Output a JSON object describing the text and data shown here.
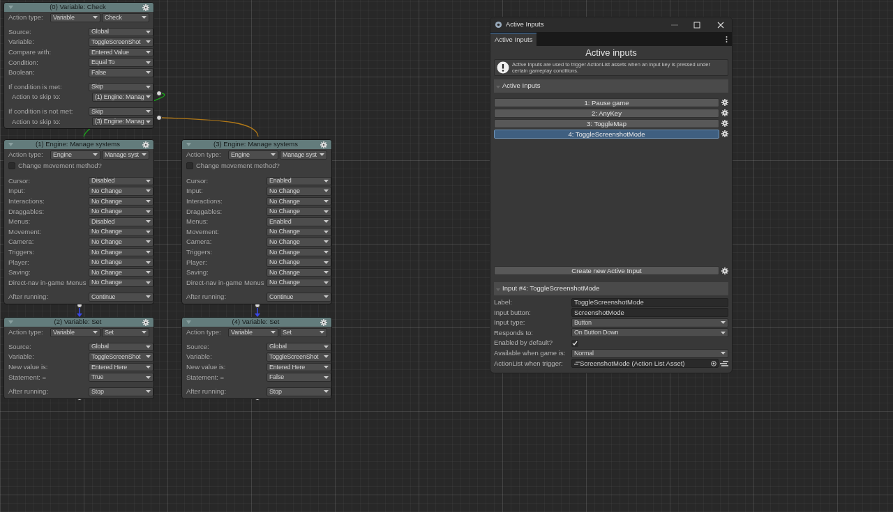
{
  "nodes": [
    {
      "title": "(0) Variable: Check",
      "groups": [
        [
          {
            "kind": "type",
            "label": "Action type:",
            "value": "Variable",
            "value2": "Check"
          }
        ],
        [
          {
            "kind": "dropdown",
            "label": "Source:",
            "value": "Global"
          },
          {
            "kind": "dropdown",
            "label": "Variable:",
            "value": "ToggleScreenShot"
          },
          {
            "kind": "dropdown",
            "label": "Compare with:",
            "value": "Entered Value"
          },
          {
            "kind": "dropdown",
            "label": "Condition:",
            "value": "Equal To"
          },
          {
            "kind": "dropdown",
            "label": "Boolean:",
            "value": "False"
          }
        ],
        [
          {
            "kind": "dropdown",
            "label": "If condition is met:",
            "value": "Skip"
          },
          {
            "kind": "skip",
            "label": "Action to skip to:",
            "value": "(1) Engine: Manag"
          }
        ],
        [
          {
            "kind": "dropdown",
            "label": "If condition is not met:",
            "value": "Skip"
          },
          {
            "kind": "skip",
            "label": "Action to skip to:",
            "value": "(3) Engine: Manag"
          }
        ]
      ]
    },
    {
      "title": "(1) Engine: Manage systems",
      "groups": [
        [
          {
            "kind": "type",
            "label": "Action type:",
            "value": "Engine",
            "value2": "Manage syst"
          },
          {
            "kind": "checkbox",
            "label": "Change movement method?",
            "checked": false
          }
        ],
        [
          {
            "kind": "dropdown",
            "label": "Cursor:",
            "value": "Disabled"
          },
          {
            "kind": "dropdown",
            "label": "Input:",
            "value": "No Change"
          },
          {
            "kind": "dropdown",
            "label": "Interactions:",
            "value": "No Change"
          },
          {
            "kind": "dropdown",
            "label": "Draggables:",
            "value": "No Change"
          },
          {
            "kind": "dropdown",
            "label": "Menus:",
            "value": "Disabled"
          },
          {
            "kind": "dropdown",
            "label": "Movement:",
            "value": "No Change"
          },
          {
            "kind": "dropdown",
            "label": "Camera:",
            "value": "No Change"
          },
          {
            "kind": "dropdown",
            "label": "Triggers:",
            "value": "No Change"
          },
          {
            "kind": "dropdown",
            "label": "Player:",
            "value": "No Change"
          },
          {
            "kind": "dropdown",
            "label": "Saving:",
            "value": "No Change"
          },
          {
            "kind": "dropdown",
            "label": "Direct-nav in-game Menus",
            "value": "No Change"
          }
        ],
        [
          {
            "kind": "dropdown",
            "label": "After running:",
            "value": "Continue"
          }
        ]
      ]
    },
    {
      "title": "(3) Engine: Manage systems",
      "groups": [
        [
          {
            "kind": "type",
            "label": "Action type:",
            "value": "Engine",
            "value2": "Manage syst"
          },
          {
            "kind": "checkbox",
            "label": "Change movement method?",
            "checked": false
          }
        ],
        [
          {
            "kind": "dropdown",
            "label": "Cursor:",
            "value": "Enabled"
          },
          {
            "kind": "dropdown",
            "label": "Input:",
            "value": "No Change"
          },
          {
            "kind": "dropdown",
            "label": "Interactions:",
            "value": "No Change"
          },
          {
            "kind": "dropdown",
            "label": "Draggables:",
            "value": "No Change"
          },
          {
            "kind": "dropdown",
            "label": "Menus:",
            "value": "Enabled"
          },
          {
            "kind": "dropdown",
            "label": "Movement:",
            "value": "No Change"
          },
          {
            "kind": "dropdown",
            "label": "Camera:",
            "value": "No Change"
          },
          {
            "kind": "dropdown",
            "label": "Triggers:",
            "value": "No Change"
          },
          {
            "kind": "dropdown",
            "label": "Player:",
            "value": "No Change"
          },
          {
            "kind": "dropdown",
            "label": "Saving:",
            "value": "No Change"
          },
          {
            "kind": "dropdown",
            "label": "Direct-nav in-game Menus",
            "value": "No Change"
          }
        ],
        [
          {
            "kind": "dropdown",
            "label": "After running:",
            "value": "Continue"
          }
        ]
      ]
    },
    {
      "title": "(2) Variable: Set",
      "groups": [
        [
          {
            "kind": "type",
            "label": "Action type:",
            "value": "Variable",
            "value2": "Set"
          }
        ],
        [
          {
            "kind": "dropdown",
            "label": "Source:",
            "value": "Global"
          },
          {
            "kind": "dropdown",
            "label": "Variable:",
            "value": "ToggleScreenShot"
          },
          {
            "kind": "dropdown",
            "label": "New value is:",
            "value": "Entered Here"
          },
          {
            "kind": "dropdown",
            "label": "Statement: =",
            "value": "True"
          }
        ],
        [
          {
            "kind": "dropdown",
            "label": "After running:",
            "value": "Stop"
          }
        ]
      ]
    },
    {
      "title": "(4) Variable: Set",
      "groups": [
        [
          {
            "kind": "type",
            "label": "Action type:",
            "value": "Variable",
            "value2": "Set"
          }
        ],
        [
          {
            "kind": "dropdown",
            "label": "Source:",
            "value": "Global"
          },
          {
            "kind": "dropdown",
            "label": "Variable:",
            "value": "ToggleScreenShot"
          },
          {
            "kind": "dropdown",
            "label": "New value is:",
            "value": "Entered Here"
          },
          {
            "kind": "dropdown",
            "label": "Statement: =",
            "value": "False"
          }
        ],
        [
          {
            "kind": "dropdown",
            "label": "After running:",
            "value": "Stop"
          }
        ]
      ]
    }
  ],
  "window": {
    "title": "Active Inputs",
    "tab": "Active Inputs",
    "heading": "Active inputs",
    "info": "Active Inputs are used to trigger ActionList assets when an input key is pressed under certain gameplay conditions.",
    "list_section": "Active Inputs",
    "inputs": [
      {
        "label": "1: Pause game",
        "selected": false
      },
      {
        "label": "2: AnyKey",
        "selected": false
      },
      {
        "label": "3: ToggleMap",
        "selected": false
      },
      {
        "label": "4: ToggleScreenshotMode",
        "selected": true
      }
    ],
    "create_button": "Create new Active Input",
    "detail_section": "Input #4: ToggleScreenshotMode",
    "fields": [
      {
        "kind": "text",
        "label": "Label:",
        "value": "ToggleScreenshotMode"
      },
      {
        "kind": "text",
        "label": "Input button:",
        "value": "ScreenshotMode"
      },
      {
        "kind": "dropdown",
        "label": "Input type:",
        "value": "Button"
      },
      {
        "kind": "dropdown",
        "label": "Responds to:",
        "value": "On Button Down"
      },
      {
        "kind": "checkbox",
        "label": "Enabled by default?",
        "checked": true
      },
      {
        "kind": "dropdown",
        "label": "Available when game is:",
        "value": "Normal"
      },
      {
        "kind": "object",
        "label": "ActionList when trigger:",
        "value": "ScreenshotMode (Action List Asset)"
      }
    ]
  }
}
